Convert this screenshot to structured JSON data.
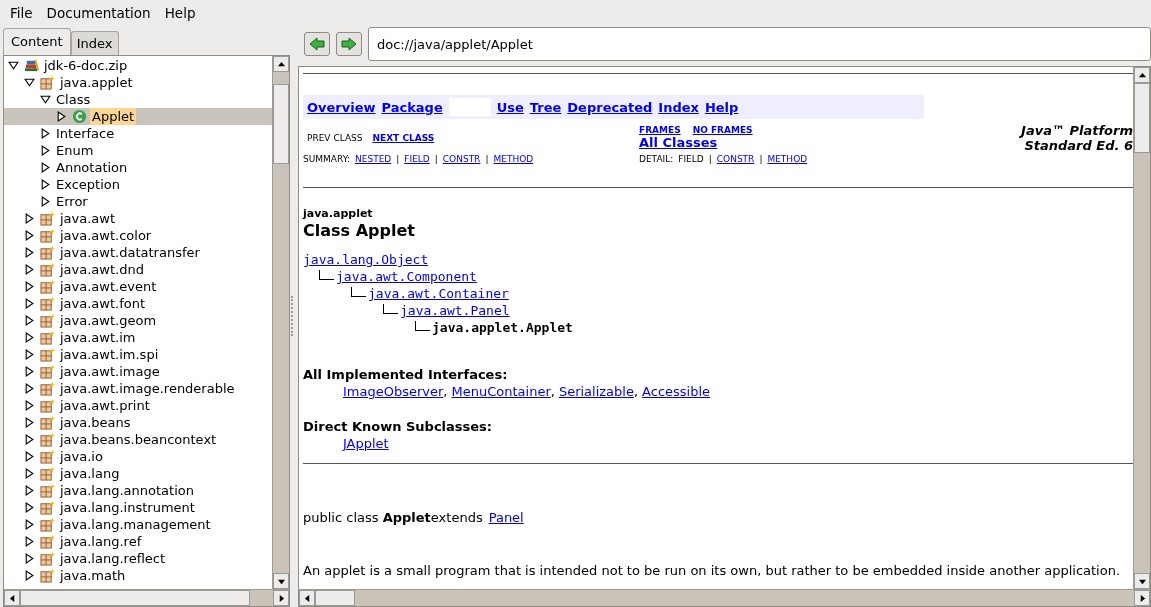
{
  "menu": [
    "File",
    "Documentation",
    "Help"
  ],
  "tabs": [
    {
      "label": "Content",
      "selected": true
    },
    {
      "label": "Index",
      "selected": false
    }
  ],
  "tree": [
    {
      "label": "jdk-6-doc.zip",
      "kind": "archive",
      "expanded": true,
      "selected": false,
      "children": [
        {
          "label": "java.applet",
          "kind": "package",
          "expanded": true,
          "selected": false,
          "children": [
            {
              "label": "Class",
              "kind": "category",
              "expanded": true,
              "selected": false,
              "children": [
                {
                  "label": "Applet",
                  "kind": "class",
                  "expanded": false,
                  "selected": true
                }
              ]
            },
            {
              "label": "Interface",
              "kind": "category",
              "expanded": false,
              "selected": false
            },
            {
              "label": "Enum",
              "kind": "category",
              "expanded": false,
              "selected": false
            },
            {
              "label": "Annotation",
              "kind": "category",
              "expanded": false,
              "selected": false
            },
            {
              "label": "Exception",
              "kind": "category",
              "expanded": false,
              "selected": false
            },
            {
              "label": "Error",
              "kind": "category",
              "expanded": false,
              "selected": false
            }
          ]
        },
        {
          "label": "java.awt",
          "kind": "package",
          "expanded": false,
          "selected": false
        },
        {
          "label": "java.awt.color",
          "kind": "package",
          "expanded": false,
          "selected": false
        },
        {
          "label": "java.awt.datatransfer",
          "kind": "package",
          "expanded": false,
          "selected": false
        },
        {
          "label": "java.awt.dnd",
          "kind": "package",
          "expanded": false,
          "selected": false
        },
        {
          "label": "java.awt.event",
          "kind": "package",
          "expanded": false,
          "selected": false
        },
        {
          "label": "java.awt.font",
          "kind": "package",
          "expanded": false,
          "selected": false
        },
        {
          "label": "java.awt.geom",
          "kind": "package",
          "expanded": false,
          "selected": false
        },
        {
          "label": "java.awt.im",
          "kind": "package",
          "expanded": false,
          "selected": false
        },
        {
          "label": "java.awt.im.spi",
          "kind": "package",
          "expanded": false,
          "selected": false
        },
        {
          "label": "java.awt.image",
          "kind": "package",
          "expanded": false,
          "selected": false
        },
        {
          "label": "java.awt.image.renderable",
          "kind": "package",
          "expanded": false,
          "selected": false
        },
        {
          "label": "java.awt.print",
          "kind": "package",
          "expanded": false,
          "selected": false
        },
        {
          "label": "java.beans",
          "kind": "package",
          "expanded": false,
          "selected": false
        },
        {
          "label": "java.beans.beancontext",
          "kind": "package",
          "expanded": false,
          "selected": false
        },
        {
          "label": "java.io",
          "kind": "package",
          "expanded": false,
          "selected": false
        },
        {
          "label": "java.lang",
          "kind": "package",
          "expanded": false,
          "selected": false
        },
        {
          "label": "java.lang.annotation",
          "kind": "package",
          "expanded": false,
          "selected": false
        },
        {
          "label": "java.lang.instrument",
          "kind": "package",
          "expanded": false,
          "selected": false
        },
        {
          "label": "java.lang.management",
          "kind": "package",
          "expanded": false,
          "selected": false
        },
        {
          "label": "java.lang.ref",
          "kind": "package",
          "expanded": false,
          "selected": false
        },
        {
          "label": "java.lang.reflect",
          "kind": "package",
          "expanded": false,
          "selected": false
        },
        {
          "label": "java.math",
          "kind": "package",
          "expanded": false,
          "selected": false
        }
      ]
    }
  ],
  "address": {
    "value": "doc://java/applet/Applet"
  },
  "doc": {
    "nav_before": [
      "Overview",
      "Package"
    ],
    "nav_after": [
      "Use",
      "Tree",
      "Deprecated",
      "Index",
      "Help"
    ],
    "platform_title": [
      "Java™ Platform",
      "Standard Ed. 6"
    ],
    "prev_next": [
      {
        "text": "PREV CLASS",
        "kind": "plain"
      },
      {
        "text": "NEXT CLASS",
        "kind": "link"
      }
    ],
    "frames": [
      "FRAMES",
      "NO FRAMES"
    ],
    "all_classes": "All Classes",
    "summary": {
      "label": "SUMMARY:",
      "items": [
        {
          "text": "NESTED",
          "kind": "link"
        },
        {
          "text": "|",
          "kind": "plain"
        },
        {
          "text": "FIELD",
          "kind": "link"
        },
        {
          "text": "|",
          "kind": "plain"
        },
        {
          "text": "CONSTR",
          "kind": "link"
        },
        {
          "text": "|",
          "kind": "plain"
        },
        {
          "text": "METHOD",
          "kind": "link"
        }
      ]
    },
    "detail": {
      "label": "DETAIL:",
      "items": [
        {
          "text": "FIELD",
          "kind": "plain"
        },
        {
          "text": "|",
          "kind": "plain"
        },
        {
          "text": "CONSTR",
          "kind": "link"
        },
        {
          "text": "|",
          "kind": "plain"
        },
        {
          "text": "METHOD",
          "kind": "link"
        }
      ]
    },
    "package": "java.applet",
    "class_title": "Class Applet",
    "hierarchy": [
      {
        "text": "java.lang.Object",
        "kind": "link"
      },
      {
        "text": "java.awt.Component",
        "kind": "link"
      },
      {
        "text": "java.awt.Container",
        "kind": "link"
      },
      {
        "text": "java.awt.Panel",
        "kind": "link"
      },
      {
        "text": "java.applet.Applet",
        "kind": "current"
      }
    ],
    "interfaces_heading": "All Implemented Interfaces:",
    "interfaces": [
      {
        "name": "ImageObserver",
        "after": ","
      },
      {
        "name": "MenuContainer",
        "after": ","
      },
      {
        "name": "Serializable",
        "after": ","
      },
      {
        "name": "Accessible"
      }
    ],
    "subclasses_heading": "Direct Known Subclasses:",
    "subclasses": [
      "JApplet"
    ],
    "declaration": "public class **Applet**extends",
    "declaration_link": "Panel",
    "description": "An applet is a small program that is intended not to be run on its own, but rather to be embedded inside another application."
  }
}
